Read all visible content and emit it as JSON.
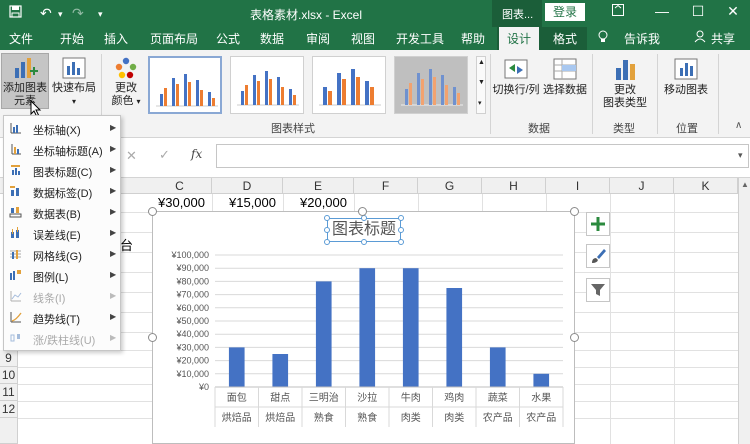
{
  "titlebar": {
    "doc_title": "表格素材.xlsx  -  Excel",
    "context_tools": "图表...",
    "login": "登录"
  },
  "tabs": [
    {
      "label": "文件"
    },
    {
      "label": "开始"
    },
    {
      "label": "插入"
    },
    {
      "label": "页面布局"
    },
    {
      "label": "公式"
    },
    {
      "label": "数据"
    },
    {
      "label": "审阅"
    },
    {
      "label": "视图"
    },
    {
      "label": "开发工具"
    },
    {
      "label": "帮助"
    },
    {
      "label": "设计"
    },
    {
      "label": "格式"
    }
  ],
  "tell_me": "告诉我",
  "share": "共享",
  "ribbon": {
    "add_element_line1": "添加图表",
    "add_element_line2": "元素",
    "quick_layout": "快速布局",
    "change_colors_line1": "更改",
    "change_colors_line2": "颜色",
    "chart_styles_group": "图表样式",
    "switch_row_col": "切换行/列",
    "select_data": "选择数据",
    "data_group": "数据",
    "change_type_line1": "更改",
    "change_type_line2": "图表类型",
    "type_group": "类型",
    "move_chart": "移动图表",
    "location_group": "位置"
  },
  "colors": {
    "excel_green": "#217346",
    "bar_blue": "#4472c4",
    "selection_blue": "#5b9bd5"
  },
  "columns": [
    "C",
    "D",
    "E",
    "F",
    "G",
    "H",
    "I",
    "J",
    "K"
  ],
  "rows": [
    "9",
    "10",
    "11",
    "12"
  ],
  "row1_cells": [
    "¥30,000",
    "¥15,000",
    "¥20,000"
  ],
  "cell_partial": "台",
  "dropdown": [
    {
      "label": "坐标轴(X)",
      "icon": "axes-icon",
      "enabled": true
    },
    {
      "label": "坐标轴标题(A)",
      "icon": "axis-title-icon",
      "enabled": true
    },
    {
      "label": "图表标题(C)",
      "icon": "chart-title-icon",
      "enabled": true
    },
    {
      "label": "数据标签(D)",
      "icon": "data-labels-icon",
      "enabled": true
    },
    {
      "label": "数据表(B)",
      "icon": "data-table-icon",
      "enabled": true
    },
    {
      "label": "误差线(E)",
      "icon": "error-bars-icon",
      "enabled": true
    },
    {
      "label": "网格线(G)",
      "icon": "gridlines-icon",
      "enabled": true
    },
    {
      "label": "图例(L)",
      "icon": "legend-icon",
      "enabled": true
    },
    {
      "label": "线条(I)",
      "icon": "lines-icon",
      "enabled": false
    },
    {
      "label": "趋势线(T)",
      "icon": "trendline-icon",
      "enabled": true
    },
    {
      "label": "涨/跌柱线(U)",
      "icon": "up-down-bars-icon",
      "enabled": false
    }
  ],
  "chart_data": {
    "type": "bar",
    "title": "图表标题",
    "categories": [
      "面包",
      "甜点",
      "三明治",
      "沙拉",
      "牛肉",
      "鸡肉",
      "蔬菜",
      "水果"
    ],
    "groups": [
      "烘焙品",
      "烘焙品",
      "熟食",
      "熟食",
      "肉类",
      "肉类",
      "农产品",
      "农产品"
    ],
    "values": [
      30000,
      25000,
      80000,
      90000,
      90000,
      75000,
      30000,
      10000
    ],
    "y_ticks": [
      "¥0",
      "¥10,000",
      "¥20,000",
      "¥30,000",
      "¥40,000",
      "¥50,000",
      "¥60,000",
      "¥70,000",
      "¥80,000",
      "¥90,000",
      "¥100,000"
    ],
    "ylim": [
      0,
      100000
    ],
    "grid": true,
    "legend": "none",
    "bar_color": "#4472c4"
  }
}
